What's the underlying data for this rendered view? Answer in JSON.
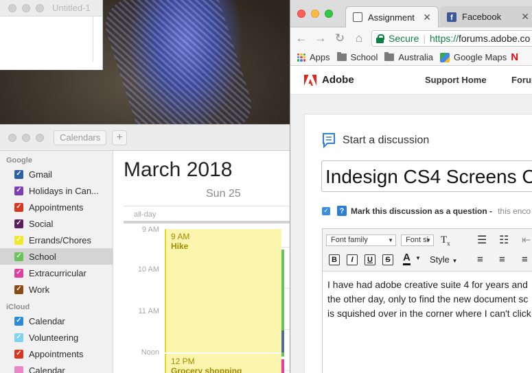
{
  "untitled_window": {
    "title": "Untitled-1"
  },
  "calendar": {
    "toolbar": {
      "calendars_label": "Calendars",
      "add_label": "+"
    },
    "groups": [
      {
        "name": "Google",
        "items": [
          {
            "label": "Gmail",
            "color": "#2f5fa4",
            "checked": true
          },
          {
            "label": "Holidays in Can...",
            "color": "#7a3fb6",
            "checked": true
          },
          {
            "label": "Appointments",
            "color": "#d9361d",
            "checked": true
          },
          {
            "label": "Social",
            "color": "#5c1f5d",
            "checked": true
          },
          {
            "label": "Errands/Chores",
            "color": "#f1e82a",
            "checked": true
          },
          {
            "label": "School",
            "color": "#69c358",
            "checked": true,
            "selected": true
          },
          {
            "label": "Extracurricular",
            "color": "#e13ea1",
            "checked": true
          },
          {
            "label": "Work",
            "color": "#8b4a10",
            "checked": true
          }
        ]
      },
      {
        "name": "iCloud",
        "items": [
          {
            "label": "Calendar",
            "color": "#2d8ad7",
            "checked": true
          },
          {
            "label": "Volunteering",
            "color": "#7fd3ee",
            "checked": true
          },
          {
            "label": "Appointments",
            "color": "#d9361d",
            "checked": true
          },
          {
            "label": "Calendar",
            "color": "#ea88c7",
            "checked": false
          }
        ]
      }
    ],
    "month_name": "March",
    "year": "2018",
    "day_label": "Sun 25",
    "all_day_label": "all-day",
    "hours": [
      "9 AM",
      "10 AM",
      "11 AM",
      "Noon"
    ],
    "events": [
      {
        "time": "9 AM",
        "title": "Hike"
      },
      {
        "time": "12 PM",
        "title": "Grocery shopping"
      }
    ]
  },
  "browser": {
    "tabs": [
      {
        "label": "Assignment",
        "active": true
      },
      {
        "label": "Facebook",
        "active": false
      }
    ],
    "address": {
      "secure_label": "Secure",
      "scheme": "https://",
      "host": "forums.adobe.co"
    },
    "bookmarks": [
      "Apps",
      "School",
      "Australia",
      "Google Maps"
    ]
  },
  "page": {
    "brand": "Adobe",
    "nav": [
      "Support Home",
      "Forun"
    ],
    "discussion_header": "Start a discussion",
    "title_value": "Indesign CS4 Screens C",
    "question_label": "Mark this discussion as a question -",
    "question_hint": "this enco",
    "editor": {
      "font_family_placeholder": "Font family",
      "font_size_placeholder": "Font si",
      "style_label": "Style",
      "content_lines": [
        " I have had adobe creative suite 4 for years and",
        "the other day, only to find the new document sc",
        "is squished over in the corner where I can't click"
      ]
    }
  }
}
